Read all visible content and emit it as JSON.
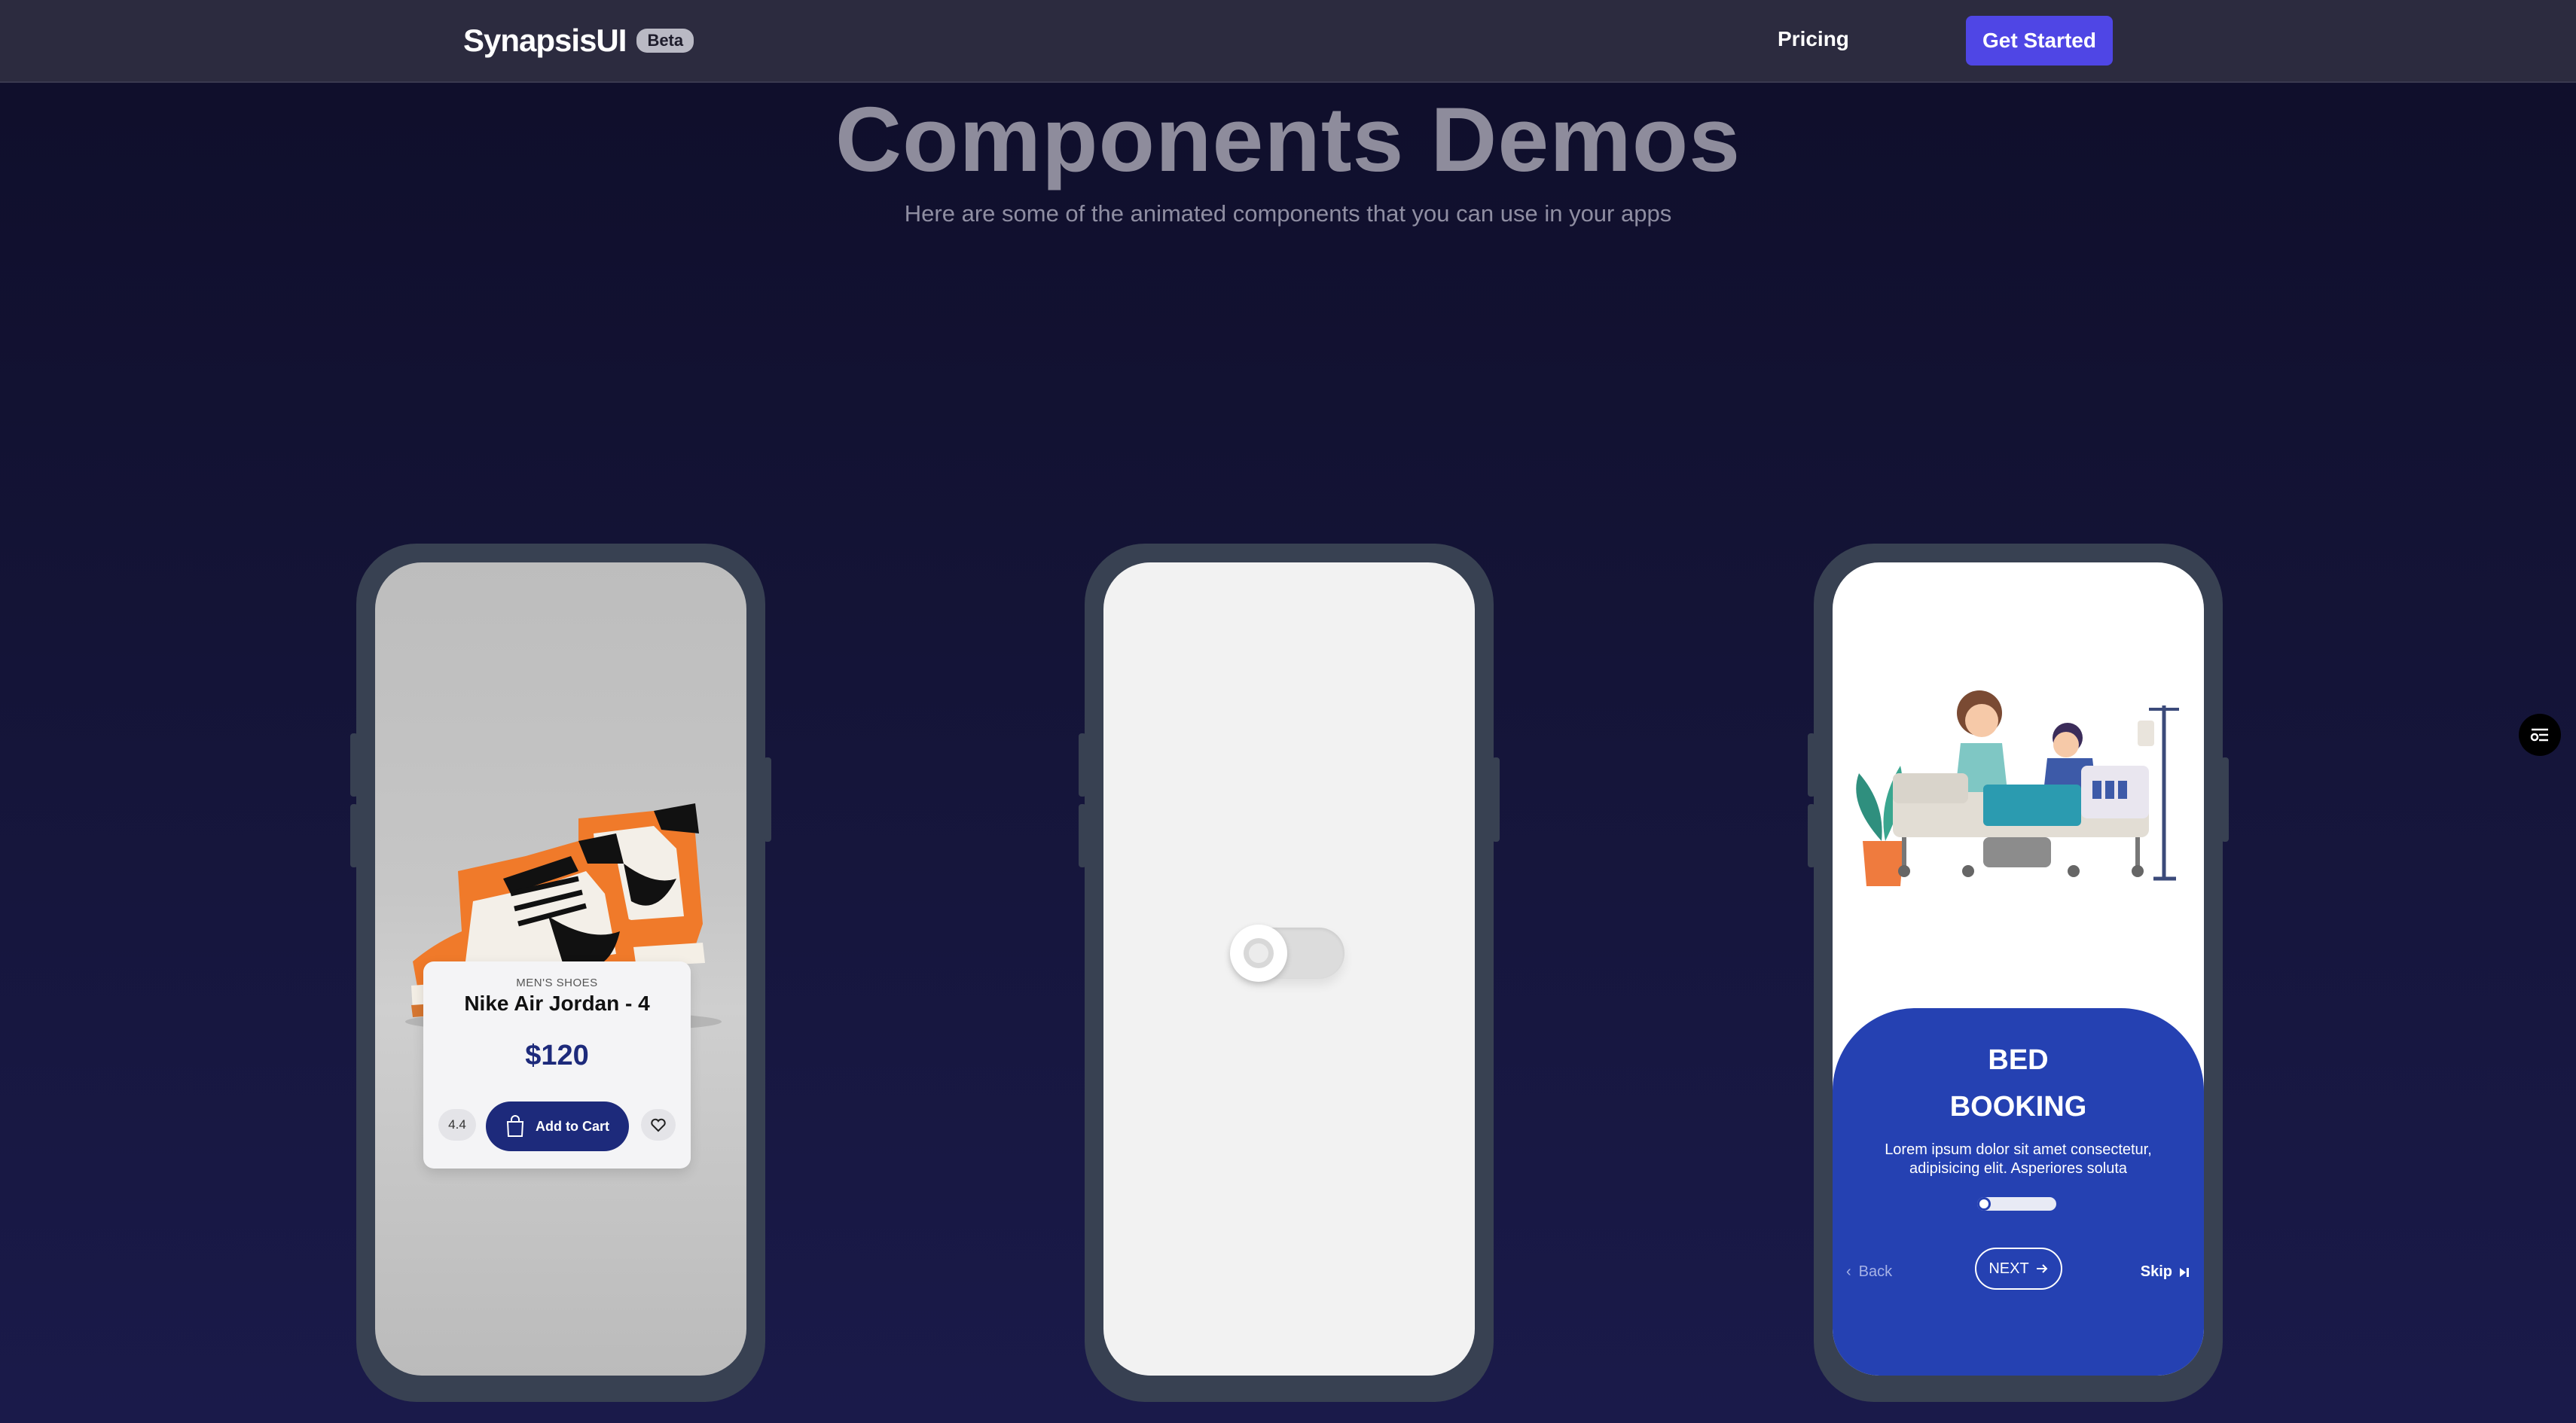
{
  "header": {
    "brand": "SynapsisUI",
    "badge": "Beta",
    "nav_pricing": "Pricing",
    "cta": "Get Started"
  },
  "hero": {
    "title": "Components Demos",
    "subtitle": "Here are some of the animated components that you can use in your apps"
  },
  "demos": {
    "product_card": {
      "category": "MEN'S SHOES",
      "name": "Nike Air Jordan - 4",
      "price": "$120",
      "rating": "4.4",
      "add_to_cart": "Add to Cart",
      "icons": [
        "sneaker-illustration",
        "shopping-bag-icon",
        "heart-icon"
      ]
    },
    "toggle": {
      "state": "off"
    },
    "onboarding": {
      "title_line1": "BED",
      "title_line2": "BOOKING",
      "description": "Lorem ipsum dolor sit amet consectetur, adipisicing elit. Asperiores soluta",
      "progress_fraction": 0.15,
      "back": "Back",
      "next": "NEXT",
      "skip": "Skip",
      "icons": [
        "hospital-bed-illustration",
        "chevron-left-icon",
        "arrow-right-icon",
        "skip-icon"
      ]
    }
  },
  "colors": {
    "accent": "#4f46e5",
    "navy": "#1d2a7b",
    "onboarding_blue": "#2541b2",
    "phone_frame": "#384152"
  }
}
